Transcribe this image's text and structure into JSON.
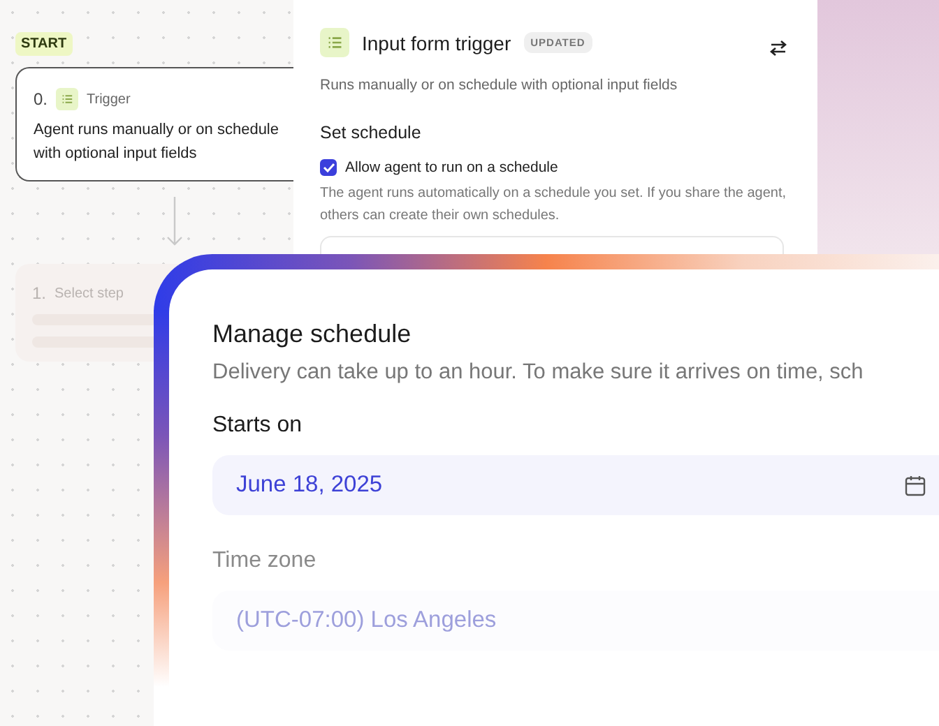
{
  "canvas": {
    "start_badge": "START",
    "trigger_card": {
      "number": "0.",
      "label": "Trigger",
      "text": "Agent runs manually or on schedule with optional input fields"
    },
    "step_card": {
      "number": "1.",
      "label": "Select step"
    }
  },
  "trigger_panel": {
    "title": "Input form trigger",
    "badge": "UPDATED",
    "subtitle": "Runs manually or on schedule with optional input fields",
    "section": "Set schedule",
    "checkbox": {
      "label": "Allow agent to run on a schedule",
      "checked": true
    },
    "description": "The agent runs automatically on a schedule you set. If you share the agent, others can create their own schedules."
  },
  "dialog": {
    "title": "Manage schedule",
    "subtitle": "Delivery can take up to an hour. To make sure it arrives on time, sch",
    "start_label": "Starts on",
    "start_value": "June 18, 2025",
    "timezone_label": "Time zone",
    "timezone_value": "(UTC-07:00) Los Angeles"
  }
}
